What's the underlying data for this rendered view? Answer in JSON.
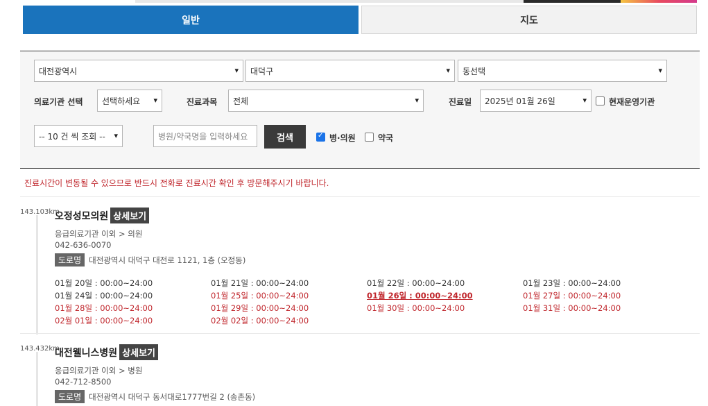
{
  "tabs": {
    "general": "일반",
    "map": "지도"
  },
  "filters": {
    "city": "대전광역시",
    "district": "대덕구",
    "dong": "동선택",
    "inst_label": "의료기관 선택",
    "inst_value": "선택하세요",
    "dept_label": "진료과목",
    "dept_value": "전체",
    "date_label": "진료일",
    "date_value": "2025년 01월 26일",
    "operating_label": "현재운영기관",
    "page_size": "-- 10 건 씩 조회 --",
    "search_placeholder": "병원/약국명을 입력하세요",
    "search_button": "검색",
    "hospital_check": "병·의원",
    "pharmacy_check": "약국"
  },
  "notice": "진료시간이 변동될 수 있으므로 반드시 전화로 진료시간 확인 후 방문해주시기 바랍니다.",
  "results": [
    {
      "distance": "143.103km",
      "name": "오정성모의원",
      "detail": "상세보기",
      "category": "응급의료기관 이외 > 의원",
      "phone": "042-636-0070",
      "road_badge": "도로명",
      "address": "대전광역시 대덕구 대전로 1121, 1층 (오정동)",
      "schedule": [
        {
          "text": "01월 20일 : 00:00~24:00",
          "style": "normal"
        },
        {
          "text": "01월 21일 : 00:00~24:00",
          "style": "normal"
        },
        {
          "text": "01월 22일 : 00:00~24:00",
          "style": "normal"
        },
        {
          "text": "01월 23일 : 00:00~24:00",
          "style": "normal"
        },
        {
          "text": "01월 24일 : 00:00~24:00",
          "style": "normal"
        },
        {
          "text": "01월 25일 : 00:00~24:00",
          "style": "red"
        },
        {
          "text": "01월 26일 : 00:00~24:00",
          "style": "today"
        },
        {
          "text": "01월 27일 : 00:00~24:00",
          "style": "red"
        },
        {
          "text": "01월 28일 : 00:00~24:00",
          "style": "red"
        },
        {
          "text": "01월 29일 : 00:00~24:00",
          "style": "red"
        },
        {
          "text": "01월 30일 : 00:00~24:00",
          "style": "red"
        },
        {
          "text": "01월 31일 : 00:00~24:00",
          "style": "red"
        },
        {
          "text": "02월 01일 : 00:00~24:00",
          "style": "red"
        },
        {
          "text": "02월 02일 : 00:00~24:00",
          "style": "red"
        }
      ]
    },
    {
      "distance": "143.432km",
      "name": "대전웰니스병원",
      "detail": "상세보기",
      "category": "응급의료기관 이외 > 병원",
      "phone": "042-712-8500",
      "road_badge": "도로명",
      "address": "대전광역시 대덕구 동서대로1777번길 2 (송촌동)"
    }
  ],
  "colors": {
    "primary": "#1a73bc",
    "notice_red": "#c0272d",
    "dark_button": "#3a3a3a"
  }
}
